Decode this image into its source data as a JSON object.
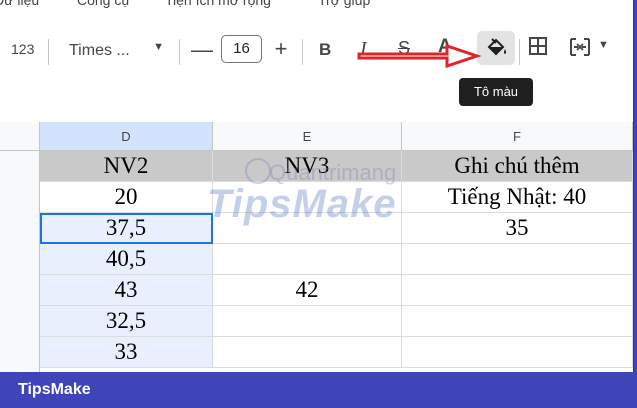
{
  "menubar": {
    "items": [
      {
        "label": "Dữ liệu"
      },
      {
        "label": "Công cụ"
      },
      {
        "label": "Tiện ích mở rộng"
      },
      {
        "label": "Trợ giúp"
      }
    ]
  },
  "toolbar": {
    "format_label": "123",
    "font_name": "Times ...",
    "font_size": "16",
    "minus": "—",
    "plus": "+",
    "bold": "B",
    "italic": "I",
    "strike": "S",
    "text_color": "A",
    "tooltip": "Tô màu"
  },
  "icons": {
    "fill": "paint-bucket-icon",
    "borders": "borders-icon",
    "merge": "merge-cells-icon"
  },
  "columns": [
    {
      "label": "D"
    },
    {
      "label": "E"
    },
    {
      "label": "F"
    }
  ],
  "rows": [
    {
      "d": "NV2",
      "e": "NV3",
      "f": "Ghi chú thêm"
    },
    {
      "d": "20",
      "e": "",
      "f": "Tiếng Nhật: 40"
    },
    {
      "d": "37,5",
      "e": "",
      "f": "35"
    },
    {
      "d": "40,5",
      "e": "",
      "f": ""
    },
    {
      "d": "43",
      "e": "42",
      "f": ""
    },
    {
      "d": "32,5",
      "e": "",
      "f": ""
    },
    {
      "d": "33",
      "e": "",
      "f": ""
    }
  ],
  "watermark": {
    "top": "Quantrimang",
    "main": "TipsMake"
  },
  "footer": {
    "brand": "TipsMake"
  },
  "colors": {
    "accent": "#1a73e8",
    "arrow": "#e0242b",
    "frame": "#3f45b8"
  }
}
